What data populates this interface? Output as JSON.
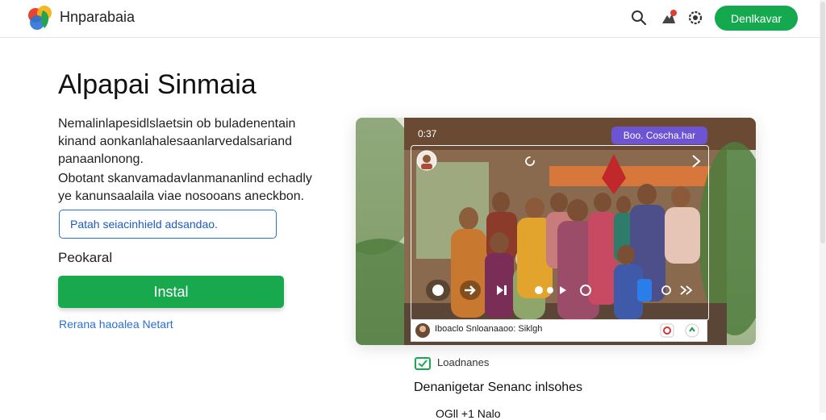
{
  "header": {
    "brand": "Hnparabaia",
    "download_label": "Denlkavar",
    "accent": "#14a84f",
    "icons": [
      "search-icon",
      "notification-icon",
      "settings-icon"
    ]
  },
  "main": {
    "title": "Alpapai Sinmaia",
    "paragraph1": "Nemalinlapesidlslaetsin ob buladenentain kinand aonkanlahalesaanlarvedalsariand panaanlonong.",
    "paragraph2": "Obotant skanvamadavlanmananlind echadly ye kanunsaalaila viae nosooans aneckbon.",
    "input_value": "Patah seiacinhield adsandao.",
    "label": "Peokaral",
    "install_label": "Instal",
    "link": "Rerana haoalea Netart"
  },
  "video": {
    "time": "0:37",
    "pill": "Boo. Coscha.har",
    "bottom_text": "Iboaclo  Snloanaaoo: Siklgh"
  },
  "footer": {
    "status": "Loadnanes",
    "caption": "Denanigetar Senanc inlsohes",
    "cutoff": "OGll +1 Nalo"
  }
}
